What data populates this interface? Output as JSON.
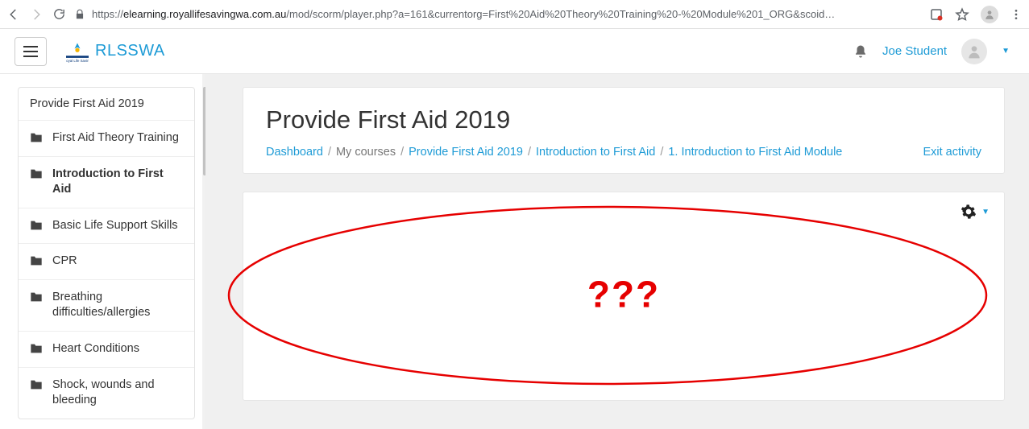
{
  "chrome": {
    "url_host": "elearning.royallifesavingwa.com.au",
    "url_path": "/mod/scorm/player.php?a=161&currentorg=First%20Aid%20Theory%20Training%20-%20Module%201_ORG&scoid…"
  },
  "header": {
    "brand": "RLSSWA",
    "brand_sub": "Royal Life Saving",
    "user": "Joe Student"
  },
  "sidebar": {
    "title": "Provide First Aid 2019",
    "items": [
      {
        "label": "First Aid Theory Training",
        "active": false
      },
      {
        "label": "Introduction to First Aid",
        "active": true
      },
      {
        "label": "Basic Life Support Skills",
        "active": false
      },
      {
        "label": "CPR",
        "active": false
      },
      {
        "label": "Breathing difficulties/allergies",
        "active": false
      },
      {
        "label": "Heart Conditions",
        "active": false
      },
      {
        "label": "Shock, wounds and bleeding",
        "active": false
      }
    ]
  },
  "main": {
    "title": "Provide First Aid 2019",
    "breadcrumbs": [
      {
        "label": "Dashboard",
        "link": true
      },
      {
        "label": "My courses",
        "link": false
      },
      {
        "label": "Provide First Aid 2019",
        "link": true
      },
      {
        "label": "Introduction to First Aid",
        "link": true
      },
      {
        "label": "1. Introduction to First Aid Module",
        "link": true
      }
    ],
    "exit_label": "Exit activity",
    "annotation": "???"
  }
}
